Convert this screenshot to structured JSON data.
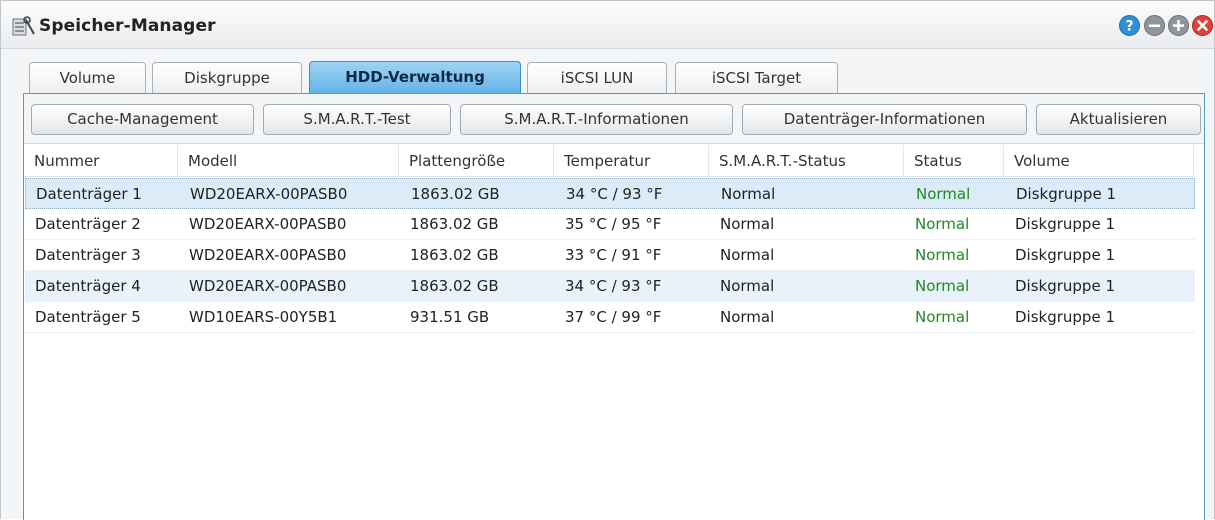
{
  "window": {
    "title": "Speicher-Manager"
  },
  "tabs": [
    {
      "label": "Volume",
      "active": false
    },
    {
      "label": "Diskgruppe",
      "active": false
    },
    {
      "label": "HDD-Verwaltung",
      "active": true
    },
    {
      "label": "iSCSI LUN",
      "active": false
    },
    {
      "label": "iSCSI Target",
      "active": false
    }
  ],
  "toolbar": {
    "cache": "Cache-Management",
    "smart_test": "S.M.A.R.T.-Test",
    "smart_info": "S.M.A.R.T.-Informationen",
    "disk_info": "Datenträger-Informationen",
    "refresh": "Aktualisieren"
  },
  "table": {
    "columns": [
      "Nummer",
      "Modell",
      "Plattengröße",
      "Temperatur",
      "S.M.A.R.T.-Status",
      "Status",
      "Volume"
    ],
    "rows": [
      {
        "nummer": "Datenträger 1",
        "modell": "WD20EARX-00PASB0",
        "groesse": "1863.02 GB",
        "temperatur": "34 °C / 93 °F",
        "smart": "Normal",
        "status": "Normal",
        "volume": "Diskgruppe 1"
      },
      {
        "nummer": "Datenträger 2",
        "modell": "WD20EARX-00PASB0",
        "groesse": "1863.02 GB",
        "temperatur": "35 °C / 95 °F",
        "smart": "Normal",
        "status": "Normal",
        "volume": "Diskgruppe 1"
      },
      {
        "nummer": "Datenträger 3",
        "modell": "WD20EARX-00PASB0",
        "groesse": "1863.02 GB",
        "temperatur": "33 °C / 91 °F",
        "smart": "Normal",
        "status": "Normal",
        "volume": "Diskgruppe 1"
      },
      {
        "nummer": "Datenträger 4",
        "modell": "WD20EARX-00PASB0",
        "groesse": "1863.02 GB",
        "temperatur": "34 °C / 93 °F",
        "smart": "Normal",
        "status": "Normal",
        "volume": "Diskgruppe 1"
      },
      {
        "nummer": "Datenträger 5",
        "modell": "WD10EARS-00Y5B1",
        "groesse": "931.51 GB",
        "temperatur": "37 °C / 99 °F",
        "smart": "Normal",
        "status": "Normal",
        "volume": "Diskgruppe 1"
      }
    ]
  },
  "colors": {
    "accent": "#5fb2e6",
    "status_ok": "#1f8a1f",
    "selected_row": "#dcebf8"
  },
  "icons": [
    "storage-manager-icon",
    "help-icon",
    "minimize-icon",
    "maximize-icon",
    "close-icon"
  ]
}
